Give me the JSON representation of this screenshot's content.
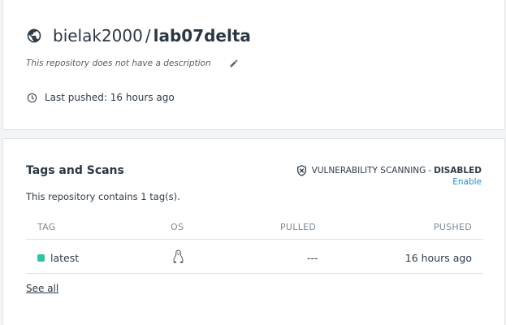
{
  "repo": {
    "owner": "bielak2000",
    "separator": "/",
    "name": "lab07delta",
    "description": "This repository does not have a description",
    "last_pushed": "Last pushed: 16 hours ago"
  },
  "tags_section": {
    "heading": "Tags and Scans",
    "vulnerability_label": "VULNERABILITY SCANNING",
    "vulnerability_separator": "-",
    "vulnerability_status": "DISABLED",
    "enable_label": "Enable",
    "count_text": "This repository contains 1 tag(s).",
    "columns": [
      "TAG",
      "OS",
      "PULLED",
      "PUSHED"
    ],
    "rows": [
      {
        "tag": "latest",
        "os": "linux-icon",
        "pulled": "---",
        "pushed": "16 hours ago"
      }
    ],
    "see_all_label": "See all"
  },
  "colors": {
    "status_dot": "#2fc1a0",
    "link": "#1d8bd0"
  }
}
